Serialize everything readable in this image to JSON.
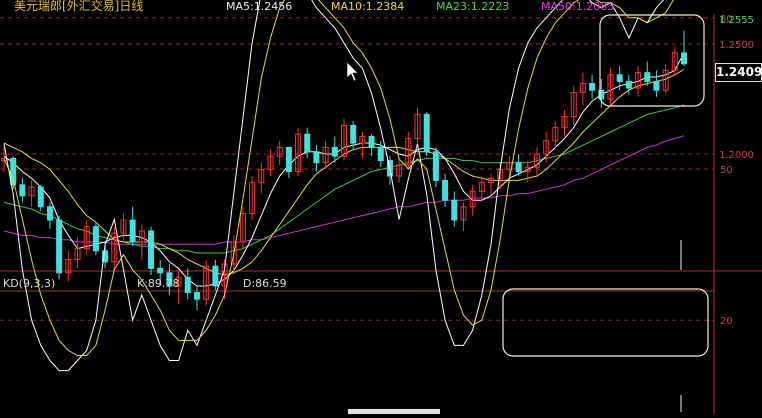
{
  "header": {
    "title": "美元瑞郎[外汇交易]日线",
    "ma5": "MA5:1.2456",
    "ma10": "MA10:1.2384",
    "ma23": "MA23:1.2223",
    "ma50": "MA50:1.2083"
  },
  "price_axis": {
    "high_label": "1.2555",
    "current_label": "1.2409",
    "ticks": [
      "1.2500",
      "1.2000"
    ]
  },
  "kd_header": {
    "name": "KD(9,3,3)",
    "k": "K:89.78",
    "d": "D:86.59"
  },
  "kd_axis": {
    "ticks": [
      "80",
      "50",
      "20"
    ]
  },
  "colors": {
    "up": "#ff3030",
    "down": "#40e0e0",
    "ma5": "#ffffff",
    "ma10": "#e8e020",
    "ma23": "#30d030",
    "ma50": "#d030d0",
    "k_line": "#ffffff",
    "d_line": "#e8e020"
  },
  "chart_data": [
    {
      "type": "candlestick",
      "title": "美元瑞郎[外汇交易]日线",
      "y_ticks": [
        1.25,
        1.2
      ],
      "current": 1.2409,
      "high": 1.2555,
      "candles": [
        [
          1.197,
          1.203,
          1.192,
          1.198
        ],
        [
          1.198,
          1.199,
          1.184,
          1.186
        ],
        [
          1.186,
          1.189,
          1.178,
          1.181
        ],
        [
          1.181,
          1.188,
          1.176,
          1.185
        ],
        [
          1.185,
          1.186,
          1.174,
          1.176
        ],
        [
          1.176,
          1.178,
          1.166,
          1.17
        ],
        [
          1.17,
          1.172,
          1.143,
          1.146
        ],
        [
          1.146,
          1.156,
          1.142,
          1.152
        ],
        [
          1.152,
          1.162,
          1.148,
          1.157
        ],
        [
          1.157,
          1.17,
          1.154,
          1.167
        ],
        [
          1.167,
          1.169,
          1.154,
          1.156
        ],
        [
          1.156,
          1.16,
          1.148,
          1.151
        ],
        [
          1.151,
          1.167,
          1.147,
          1.164
        ],
        [
          1.164,
          1.173,
          1.16,
          1.17
        ],
        [
          1.17,
          1.176,
          1.158,
          1.16
        ],
        [
          1.16,
          1.168,
          1.152,
          1.165
        ],
        [
          1.165,
          1.167,
          1.145,
          1.148
        ],
        [
          1.148,
          1.152,
          1.14,
          1.146
        ],
        [
          1.146,
          1.15,
          1.136,
          1.14
        ],
        [
          1.14,
          1.147,
          1.132,
          1.144
        ],
        [
          1.144,
          1.148,
          1.134,
          1.137
        ],
        [
          1.137,
          1.14,
          1.129,
          1.134
        ],
        [
          1.134,
          1.152,
          1.131,
          1.149
        ],
        [
          1.149,
          1.152,
          1.138,
          1.14
        ],
        [
          1.14,
          1.152,
          1.134,
          1.15
        ],
        [
          1.15,
          1.163,
          1.146,
          1.16
        ],
        [
          1.16,
          1.176,
          1.157,
          1.173
        ],
        [
          1.173,
          1.19,
          1.17,
          1.187
        ],
        [
          1.187,
          1.196,
          1.182,
          1.193
        ],
        [
          1.193,
          1.202,
          1.19,
          1.199
        ],
        [
          1.199,
          1.206,
          1.195,
          1.203
        ],
        [
          1.203,
          1.203,
          1.189,
          1.192
        ],
        [
          1.192,
          1.212,
          1.19,
          1.209
        ],
        [
          1.209,
          1.212,
          1.198,
          1.201
        ],
        [
          1.201,
          1.204,
          1.192,
          1.196
        ],
        [
          1.196,
          1.206,
          1.193,
          1.203
        ],
        [
          1.203,
          1.208,
          1.196,
          1.199
        ],
        [
          1.199,
          1.216,
          1.197,
          1.213
        ],
        [
          1.213,
          1.215,
          1.202,
          1.205
        ],
        [
          1.205,
          1.21,
          1.198,
          1.208
        ],
        [
          1.208,
          1.209,
          1.199,
          1.203
        ],
        [
          1.203,
          1.206,
          1.194,
          1.197
        ],
        [
          1.197,
          1.199,
          1.186,
          1.19
        ],
        [
          1.19,
          1.198,
          1.187,
          1.195
        ],
        [
          1.195,
          1.21,
          1.193,
          1.207
        ],
        [
          1.207,
          1.221,
          1.205,
          1.218
        ],
        [
          1.218,
          1.219,
          1.199,
          1.201
        ],
        [
          1.201,
          1.203,
          1.185,
          1.188
        ],
        [
          1.188,
          1.191,
          1.176,
          1.179
        ],
        [
          1.179,
          1.183,
          1.167,
          1.17
        ],
        [
          1.17,
          1.178,
          1.165,
          1.176
        ],
        [
          1.176,
          1.186,
          1.172,
          1.183
        ],
        [
          1.183,
          1.19,
          1.179,
          1.187
        ],
        [
          1.187,
          1.191,
          1.181,
          1.189
        ],
        [
          1.189,
          1.196,
          1.184,
          1.193
        ],
        [
          1.193,
          1.199,
          1.187,
          1.196
        ],
        [
          1.196,
          1.2,
          1.19,
          1.192
        ],
        [
          1.192,
          1.197,
          1.187,
          1.194
        ],
        [
          1.194,
          1.203,
          1.19,
          1.2
        ],
        [
          1.2,
          1.21,
          1.196,
          1.206
        ],
        [
          1.206,
          1.215,
          1.202,
          1.212
        ],
        [
          1.212,
          1.22,
          1.208,
          1.217
        ],
        [
          1.217,
          1.231,
          1.213,
          1.228
        ],
        [
          1.228,
          1.237,
          1.222,
          1.232
        ],
        [
          1.232,
          1.236,
          1.225,
          1.229
        ],
        [
          1.229,
          1.234,
          1.221,
          1.225
        ],
        [
          1.225,
          1.239,
          1.222,
          1.236
        ],
        [
          1.236,
          1.24,
          1.229,
          1.233
        ],
        [
          1.233,
          1.236,
          1.227,
          1.23
        ],
        [
          1.23,
          1.24,
          1.226,
          1.237
        ],
        [
          1.237,
          1.242,
          1.231,
          1.233
        ],
        [
          1.233,
          1.238,
          1.226,
          1.229
        ],
        [
          1.229,
          1.241,
          1.227,
          1.238
        ],
        [
          1.238,
          1.249,
          1.236,
          1.246
        ],
        [
          1.246,
          1.256,
          1.24,
          1.241
        ]
      ],
      "ma5": [
        1.199,
        1.196,
        1.192,
        1.189,
        1.185,
        1.18,
        1.17,
        1.163,
        1.157,
        1.158,
        1.159,
        1.16,
        1.162,
        1.163,
        1.163,
        1.162,
        1.16,
        1.156,
        1.151,
        1.148,
        1.143,
        1.14,
        1.14,
        1.141,
        1.143,
        1.147,
        1.154,
        1.162,
        1.172,
        1.182,
        1.19,
        1.195,
        1.199,
        1.201,
        1.201,
        1.2,
        1.2,
        1.203,
        1.204,
        1.205,
        1.205,
        1.204,
        1.202,
        1.2,
        1.199,
        1.202,
        1.203,
        1.202,
        1.198,
        1.191,
        1.183,
        1.179,
        1.179,
        1.181,
        1.185,
        1.189,
        1.191,
        1.193,
        1.195,
        1.199,
        1.203,
        1.207,
        1.212,
        1.219,
        1.224,
        1.227,
        1.229,
        1.231,
        1.232,
        1.233,
        1.235,
        1.235,
        1.236,
        1.238,
        1.246
      ],
      "ma10": [
        1.205,
        1.203,
        1.201,
        1.198,
        1.196,
        1.193,
        1.188,
        1.183,
        1.177,
        1.172,
        1.169,
        1.165,
        1.161,
        1.16,
        1.16,
        1.16,
        1.16,
        1.159,
        1.157,
        1.155,
        1.152,
        1.15,
        1.148,
        1.146,
        1.145,
        1.146,
        1.148,
        1.151,
        1.156,
        1.162,
        1.168,
        1.174,
        1.18,
        1.186,
        1.191,
        1.194,
        1.197,
        1.2,
        1.202,
        1.203,
        1.203,
        1.203,
        1.203,
        1.203,
        1.202,
        1.201,
        1.201,
        1.2,
        1.198,
        1.195,
        1.192,
        1.19,
        1.189,
        1.188,
        1.188,
        1.188,
        1.188,
        1.189,
        1.19,
        1.193,
        1.197,
        1.201,
        1.205,
        1.21,
        1.214,
        1.218,
        1.222,
        1.226,
        1.229,
        1.231,
        1.232,
        1.233,
        1.234,
        1.236,
        1.2384
      ],
      "ma23": [
        1.178,
        1.177,
        1.176,
        1.175,
        1.173,
        1.172,
        1.17,
        1.168,
        1.166,
        1.165,
        1.163,
        1.162,
        1.161,
        1.16,
        1.159,
        1.158,
        1.158,
        1.157,
        1.157,
        1.156,
        1.156,
        1.155,
        1.155,
        1.155,
        1.155,
        1.156,
        1.157,
        1.159,
        1.161,
        1.163,
        1.166,
        1.169,
        1.172,
        1.175,
        1.178,
        1.181,
        1.184,
        1.186,
        1.188,
        1.19,
        1.192,
        1.193,
        1.194,
        1.195,
        1.196,
        1.197,
        1.198,
        1.198,
        1.198,
        1.198,
        1.197,
        1.197,
        1.196,
        1.196,
        1.196,
        1.196,
        1.196,
        1.196,
        1.197,
        1.198,
        1.199,
        1.2,
        1.202,
        1.204,
        1.206,
        1.208,
        1.21,
        1.212,
        1.214,
        1.216,
        1.218,
        1.219,
        1.22,
        1.221,
        1.2223
      ],
      "ma50": [
        1.165,
        1.164,
        1.163,
        1.163,
        1.162,
        1.162,
        1.161,
        1.161,
        1.16,
        1.16,
        1.16,
        1.16,
        1.159,
        1.159,
        1.159,
        1.159,
        1.159,
        1.159,
        1.159,
        1.159,
        1.159,
        1.159,
        1.159,
        1.159,
        1.16,
        1.16,
        1.16,
        1.161,
        1.161,
        1.162,
        1.163,
        1.164,
        1.165,
        1.166,
        1.167,
        1.168,
        1.169,
        1.17,
        1.171,
        1.172,
        1.173,
        1.174,
        1.175,
        1.176,
        1.176,
        1.177,
        1.178,
        1.178,
        1.179,
        1.179,
        1.179,
        1.18,
        1.18,
        1.18,
        1.181,
        1.181,
        1.182,
        1.182,
        1.183,
        1.184,
        1.185,
        1.186,
        1.188,
        1.189,
        1.191,
        1.193,
        1.195,
        1.197,
        1.199,
        1.201,
        1.203,
        1.204,
        1.206,
        1.207,
        1.2083
      ]
    },
    {
      "type": "line",
      "title": "KD(9,3,3)",
      "y_ticks": [
        80,
        50,
        20
      ],
      "ylim": [
        0,
        100
      ],
      "series": [
        {
          "name": "K",
          "values": [
            55,
            45,
            30,
            20,
            15,
            12,
            10,
            10,
            12,
            14,
            20,
            35,
            40,
            30,
            20,
            25,
            20,
            15,
            12,
            12,
            18,
            15,
            20,
            25,
            30,
            45,
            60,
            75,
            85,
            88,
            90,
            87,
            85,
            85,
            82,
            80,
            78,
            75,
            72,
            70,
            65,
            58,
            50,
            40,
            48,
            55,
            45,
            30,
            20,
            15,
            15,
            18,
            25,
            35,
            50,
            62,
            70,
            75,
            78,
            80,
            82,
            84,
            86,
            85,
            83,
            82,
            83,
            80,
            76,
            80,
            79,
            82,
            84,
            88,
            89.78
          ]
        },
        {
          "name": "D",
          "values": [
            52,
            48,
            40,
            32,
            25,
            20,
            16,
            14,
            13,
            13,
            15,
            22,
            30,
            33,
            30,
            28,
            25,
            22,
            18,
            16,
            16,
            16,
            18,
            21,
            25,
            33,
            44,
            56,
            68,
            76,
            82,
            85,
            86,
            85,
            84,
            82,
            80,
            78,
            75,
            73,
            70,
            66,
            60,
            52,
            50,
            52,
            50,
            42,
            34,
            26,
            21,
            19,
            20,
            26,
            36,
            48,
            58,
            66,
            72,
            76,
            79,
            81,
            83,
            84,
            84,
            83,
            83,
            82,
            80,
            80,
            79,
            80,
            81,
            84,
            86.59
          ]
        }
      ]
    }
  ]
}
